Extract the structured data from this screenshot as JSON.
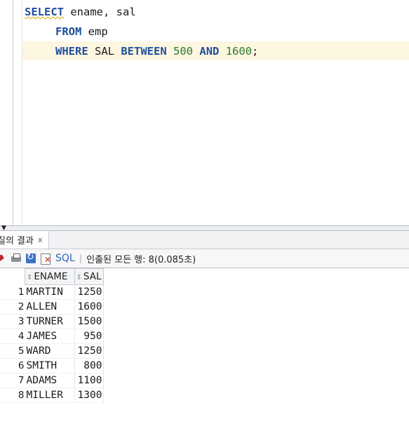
{
  "editor": {
    "line1": {
      "kw": "SELECT",
      "rest": " ename, sal"
    },
    "line2": {
      "kw": "FROM",
      "rest": " emp"
    },
    "line3": {
      "kw1": "WHERE",
      "mid1": " SAL ",
      "kw2": "BETWEEN",
      "num1": "500",
      "kw3": "AND",
      "num2": "1600",
      "tail": ";"
    }
  },
  "results_tab": {
    "label": "질의 결과",
    "close": "x"
  },
  "toolbar": {
    "sql_label": "SQL",
    "separator": "|",
    "status": "인출된 모든 행: 8(0.085초)"
  },
  "grid": {
    "columns": [
      "ENAME",
      "SAL"
    ],
    "sort_glyph": "⇕",
    "rows": [
      {
        "n": "1",
        "ename": "MARTIN",
        "sal": "1250"
      },
      {
        "n": "2",
        "ename": "ALLEN",
        "sal": "1600"
      },
      {
        "n": "3",
        "ename": "TURNER",
        "sal": "1500"
      },
      {
        "n": "4",
        "ename": "JAMES",
        "sal": "950"
      },
      {
        "n": "5",
        "ename": "WARD",
        "sal": "1250"
      },
      {
        "n": "6",
        "ename": "SMITH",
        "sal": "800"
      },
      {
        "n": "7",
        "ename": "ADAMS",
        "sal": "1100"
      },
      {
        "n": "8",
        "ename": "MILLER",
        "sal": "1300"
      }
    ]
  }
}
